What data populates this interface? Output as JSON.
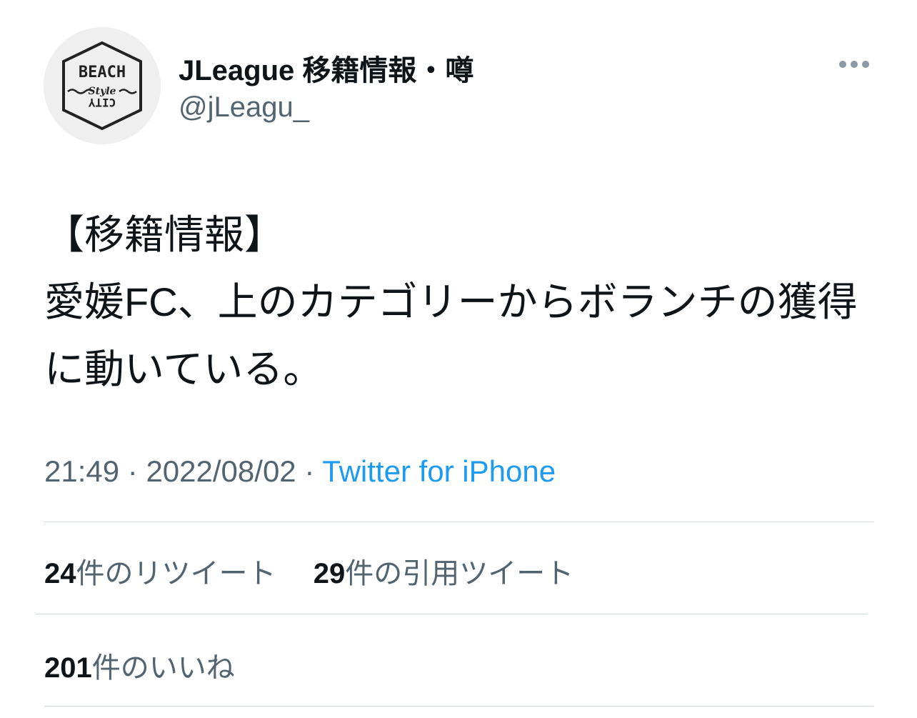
{
  "user": {
    "display_name": "JLeague 移籍情報・噂",
    "handle": "@jLeagu_",
    "avatar": {
      "top_text": "BEACH",
      "middle_text": "Style",
      "bottom_text": "CITY"
    }
  },
  "tweet": {
    "text": "【移籍情報】\n愛媛FC、上のカテゴリーからボランチの獲得に動いている。",
    "time": "21:49",
    "date": "2022/08/02",
    "separator": "·",
    "source": "Twitter for iPhone"
  },
  "stats": {
    "retweets_count": "24",
    "retweets_label": "件のリツイート",
    "quotes_count": "29",
    "quotes_label": "件の引用ツイート",
    "likes_count": "201",
    "likes_label": "件のいいね"
  },
  "colors": {
    "text": "#0f1419",
    "secondary": "#536471",
    "link": "#1d9bf0",
    "divider": "#cfd9de"
  },
  "icons": {
    "more": "more-horizontal-icon"
  }
}
